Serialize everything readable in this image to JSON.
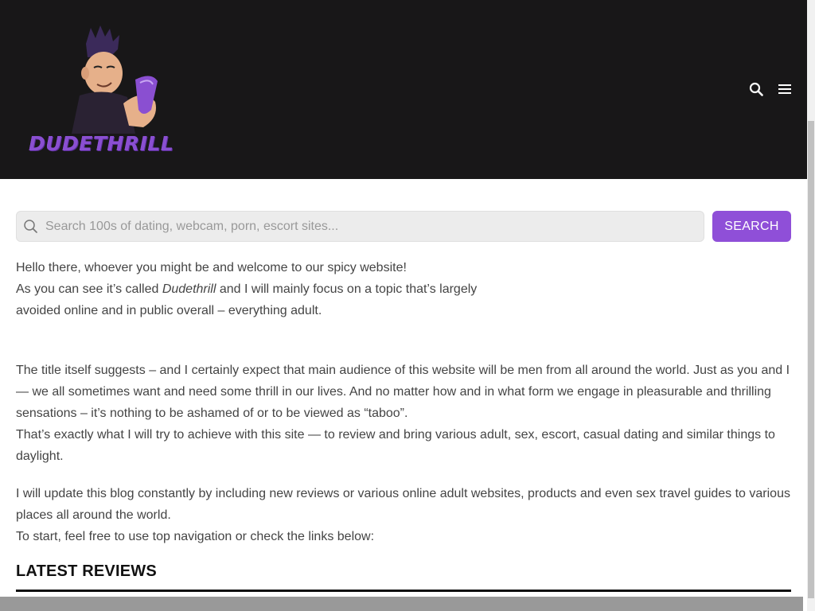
{
  "header": {
    "logo_text": "DUDETHRILL",
    "icons": [
      "search-icon",
      "menu-icon"
    ]
  },
  "search": {
    "placeholder": "Search 100s of dating, webcam, porn, escort sites...",
    "value": "",
    "button_label": "SEARCH"
  },
  "intro": {
    "line1": "Hello there, whoever you might be and welcome to our spicy website!",
    "line2_pre": "As you can see it’s called ",
    "line2_name": "Dudethrill",
    "line2_post": " and I will mainly focus on a topic that’s largely avoided online and in public overall – everything adult.",
    "para2a": "The title itself suggests – and I certainly expect that main audience of this website will be men from all around the world. Just as you and I — we all sometimes want and need some thrill in our lives. And no matter how and in what form we engage in pleasurable and thrilling sensations – it’s nothing to be ashamed of or to be viewed as “taboo”.",
    "para2b": "That’s exactly what I will try to achieve with this site — to review and bring various adult, sex, escort, casual dating and similar things to daylight.",
    "para3a": "I will update this blog constantly by including new reviews or various online adult websites, products and even sex travel guides to various places all around the world.",
    "para3b": "To start, feel free to use top navigation or check the links below:"
  },
  "section": {
    "title": "LATEST REVIEWS"
  },
  "colors": {
    "header_bg": "#181718",
    "accent": "#8f4fd8"
  }
}
